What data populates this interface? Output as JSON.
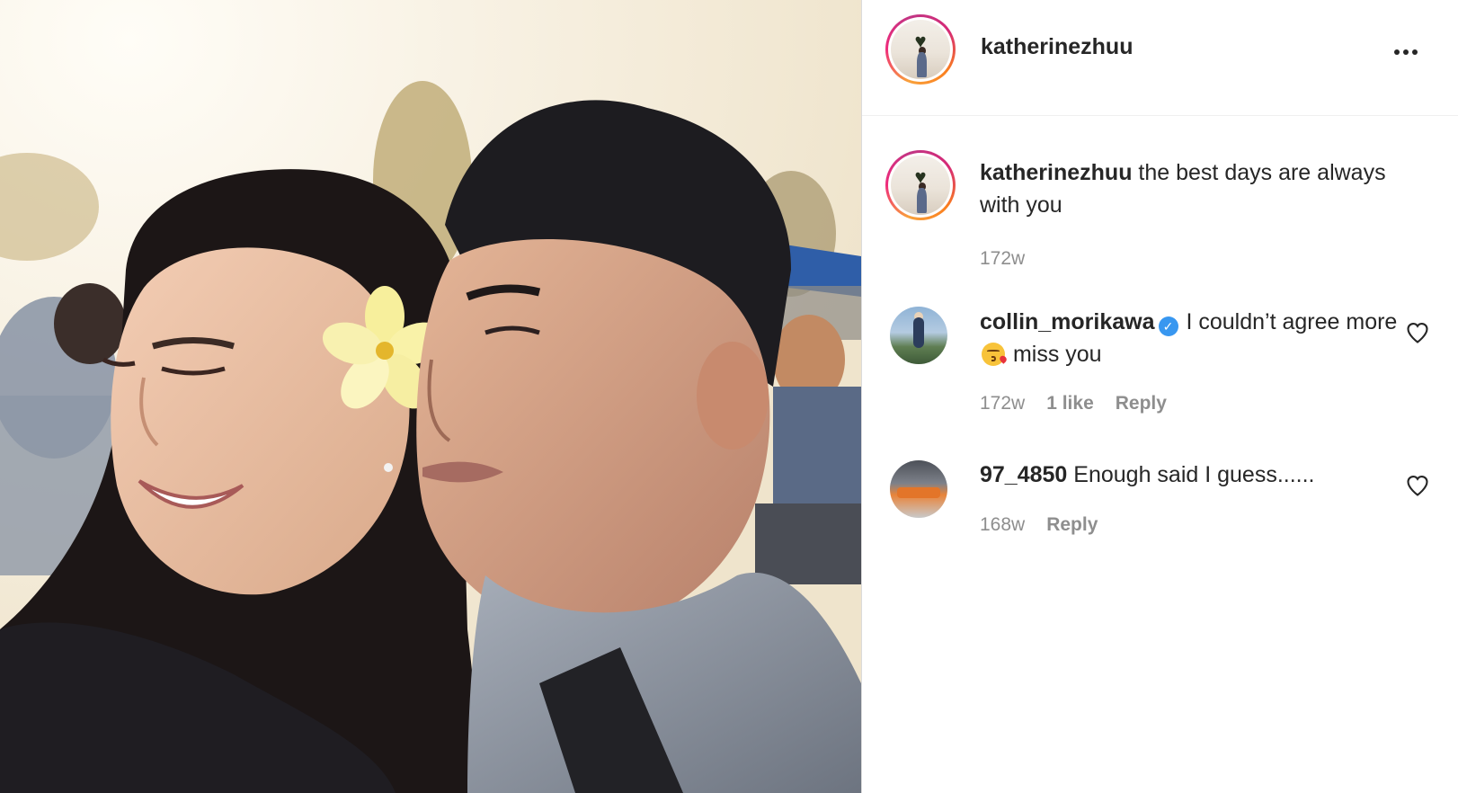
{
  "post": {
    "author": "katherinezhuu",
    "more_icon": "more-horizontal-icon"
  },
  "caption": {
    "username": "katherinezhuu",
    "text": " the best days are always with you",
    "time": "172w"
  },
  "comments": [
    {
      "username": "collin_morikawa",
      "verified": true,
      "verified_icon": "verified-badge-icon",
      "text_before_emoji": " I couldn’t agree more ",
      "emoji": "kissing-face-emoji",
      "text_after_emoji": " miss you",
      "time": "172w",
      "likes": "1 like",
      "reply": "Reply",
      "like_icon": "heart-outline-icon"
    },
    {
      "username": "97_4850",
      "text": " Enough said I guess......",
      "time": "168w",
      "reply": "Reply",
      "like_icon": "heart-outline-icon"
    }
  ],
  "colors": {
    "text_primary": "#262626",
    "text_secondary": "#8e8e8e",
    "verified_blue": "#3897f0",
    "divider": "#efefef"
  }
}
